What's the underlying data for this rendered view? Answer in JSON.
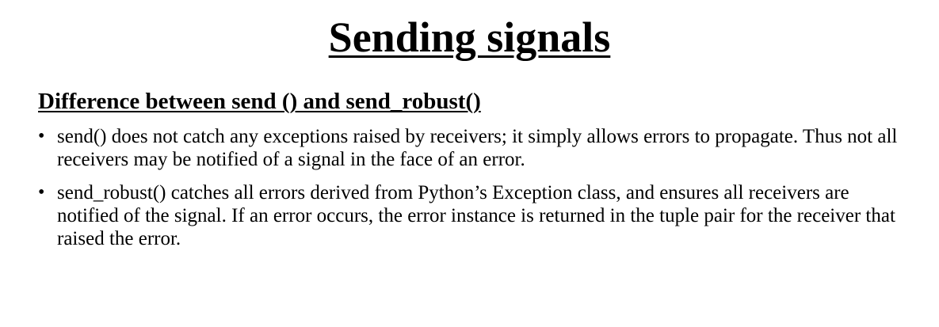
{
  "slide": {
    "title": "Sending signals",
    "subtitle": "Difference between send () and send_robust()",
    "bullets": [
      {
        "marker": "•",
        "text": "send() does not catch any exceptions raised by receivers; it simply allows errors to propagate. Thus not all receivers may be notified of a signal in the face of an error."
      },
      {
        "marker": "•",
        "text": "send_robust() catches all errors derived from Python’s Exception class, and ensures all receivers are notified of the signal. If an error occurs, the error instance is returned in the tuple pair for the receiver that raised the error."
      }
    ]
  }
}
